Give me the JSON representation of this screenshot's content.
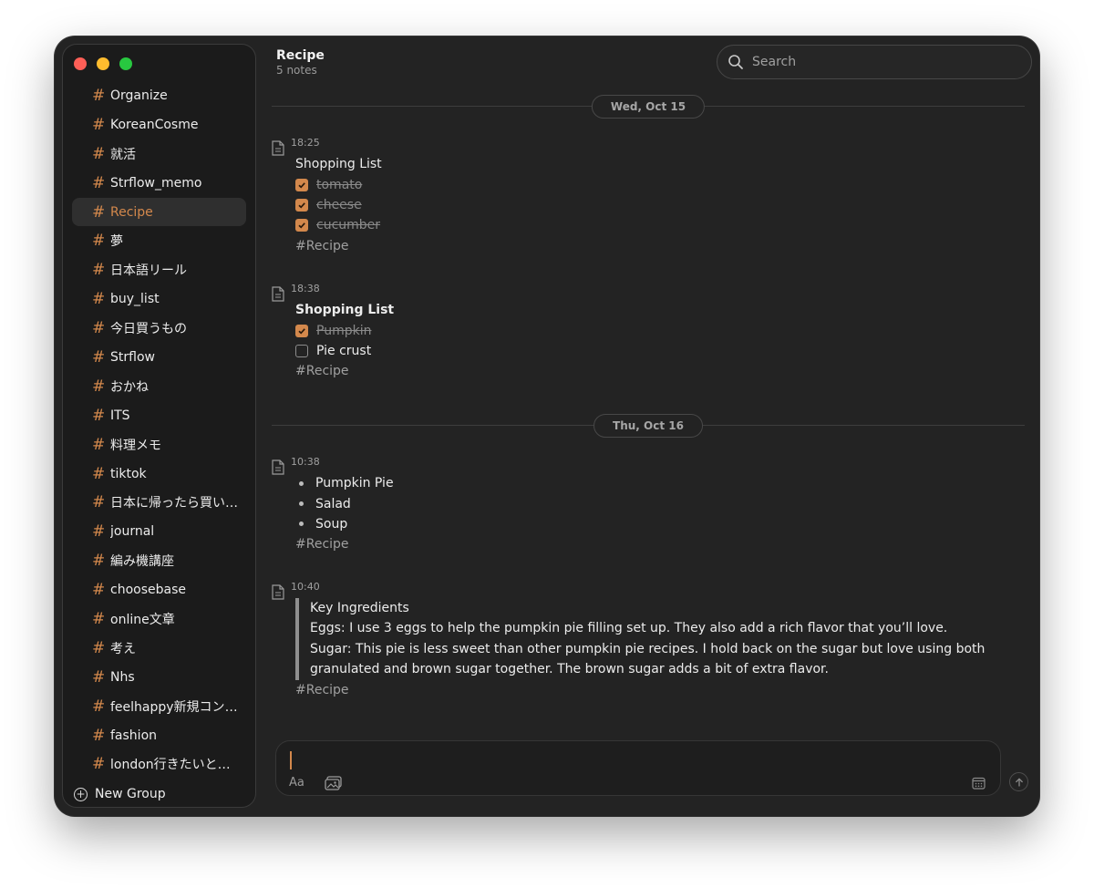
{
  "sidebar": {
    "groups": [
      {
        "name": "Organize"
      },
      {
        "name": "KoreanCosme"
      },
      {
        "name": "就活"
      },
      {
        "name": "Strflow_memo"
      },
      {
        "name": "Recipe"
      },
      {
        "name": "夢"
      },
      {
        "name": "日本語リール"
      },
      {
        "name": "buy_list"
      },
      {
        "name": "今日買うもの"
      },
      {
        "name": "Strflow"
      },
      {
        "name": "おかね"
      },
      {
        "name": "ITS"
      },
      {
        "name": "料理メモ"
      },
      {
        "name": "tiktok"
      },
      {
        "name": "日本に帰ったら買いたいもの"
      },
      {
        "name": "journal"
      },
      {
        "name": "編み機講座"
      },
      {
        "name": "choosebase"
      },
      {
        "name": "online文章"
      },
      {
        "name": "考え"
      },
      {
        "name": "Nhs"
      },
      {
        "name": "feelhappy新規コンテンツ"
      },
      {
        "name": "fashion"
      },
      {
        "name": "london行きたいところ"
      }
    ],
    "active_group": "Recipe",
    "hash_symbol": "#",
    "new_group_label": "New Group"
  },
  "header": {
    "title": "Recipe",
    "subtitle": "5 notes",
    "search_placeholder": "Search"
  },
  "dates": [
    "Wed, Oct 15",
    "Thu, Oct 16"
  ],
  "notes": [
    {
      "time": "18:25",
      "title": "Shopping List",
      "items": [
        {
          "text": "tomato",
          "checked": true
        },
        {
          "text": "cheese",
          "checked": true
        },
        {
          "text": "cucumber",
          "checked": true
        }
      ],
      "tag": "#Recipe"
    },
    {
      "time": "18:38",
      "title": "Shopping List",
      "items": [
        {
          "text": "Pumpkin",
          "checked": true
        },
        {
          "text": "Pie crust",
          "checked": false
        }
      ],
      "tag": "#Recipe"
    },
    {
      "time": "10:38",
      "bullets": [
        "Pumpkin Pie",
        "Salad",
        "Soup"
      ],
      "tag": "#Recipe"
    },
    {
      "time": "10:40",
      "quote_title": "Key Ingredients",
      "quote_lines": [
        "Eggs: I use 3 eggs to help the pumpkin pie filling set up. They also add a rich flavor that you’ll love.",
        "Sugar: This pie is less sweet than other pumpkin pie recipes. I hold back on the sugar but love using both granulated and brown sugar together. The brown sugar adds a bit of extra flavor."
      ],
      "tag": "#Recipe"
    }
  ],
  "composer": {
    "format_label": "Aa",
    "value": ""
  },
  "colors": {
    "accent": "#d3884c",
    "background": "#232323",
    "sidebar_bg": "#1b1b1b"
  }
}
